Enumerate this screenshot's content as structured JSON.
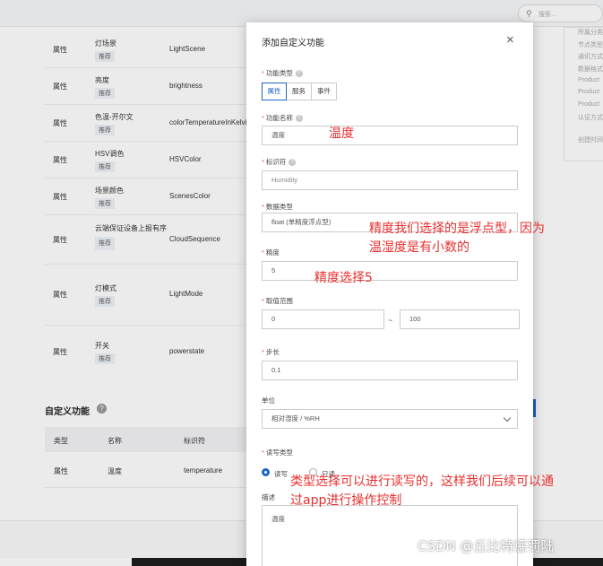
{
  "search": {
    "placeholder": "搜索..."
  },
  "standard_rows": [
    {
      "type": "属性",
      "name": "灯场景",
      "tag": "推荐",
      "identifier": "LightScene"
    },
    {
      "type": "属性",
      "name": "亮度",
      "tag": "推荐",
      "identifier": "brightness"
    },
    {
      "type": "属性",
      "name": "色温-开尔文",
      "tag": "推荐",
      "identifier": "colorTemperatureInKelvin"
    },
    {
      "type": "属性",
      "name": "HSV调色",
      "tag": "推荐",
      "identifier": "HSVColor"
    },
    {
      "type": "属性",
      "name": "场景颜色",
      "tag": "推荐",
      "identifier": "ScenesColor"
    },
    {
      "type": "属性",
      "name": "云端保证设备上报有序",
      "tag": "推荐",
      "identifier": "CloudSequence"
    },
    {
      "type": "属性",
      "name": "灯模式",
      "tag": "推荐",
      "identifier": "LightMode"
    },
    {
      "type": "属性",
      "name": "开关",
      "tag": "推荐",
      "identifier": "powerstate"
    }
  ],
  "custom": {
    "title": "自定义功能",
    "help": "?",
    "headers": [
      "类型",
      "名称",
      "标识符"
    ],
    "row": {
      "type": "属性",
      "name": "温度",
      "identifier": "temperature"
    }
  },
  "right_panel": [
    "所属分类",
    "节点类型",
    "通讯方式",
    "数据格式",
    "Product",
    "Product",
    "Product",
    "认证方式",
    "创建时间"
  ],
  "modal": {
    "title": "添加自定义功能",
    "close": "×",
    "function_type": {
      "label": "功能类型",
      "options": [
        "属性",
        "服务",
        "事件"
      ],
      "selected": "属性"
    },
    "function_name": {
      "label": "功能名称",
      "value": "温度"
    },
    "identifier": {
      "label": "标识符",
      "value": "Humidity"
    },
    "data_type": {
      "label": "数据类型",
      "value": "float (单精度浮点型)"
    },
    "precision": {
      "label": "精度",
      "value": "5"
    },
    "range": {
      "label": "取值范围",
      "min": "0",
      "sep": "~",
      "max": "100"
    },
    "step": {
      "label": "步长",
      "value": "0.1"
    },
    "unit": {
      "label": "单位",
      "value": "相对湿度 / %RH"
    },
    "rw_type": {
      "label": "读写类型",
      "options": [
        "读写",
        "只读"
      ],
      "selected": "读写"
    },
    "description": {
      "label": "描述",
      "value": "温度"
    }
  },
  "annotations": {
    "name_note": "温度",
    "datatype_note_1": "精度我们选择的是浮点型，因为",
    "datatype_note_2": "温湿度是有小数的",
    "precision_note": "精度选择5",
    "rw_note_1": "类型选择可以进行读写的，这样我们后续可以通",
    "rw_note_2": "过app进行操作控制"
  },
  "watermark": "CSDN @丘比特惩罚陆",
  "colors": {
    "primary": "#1c64c6",
    "annotation": "#e8302f"
  }
}
